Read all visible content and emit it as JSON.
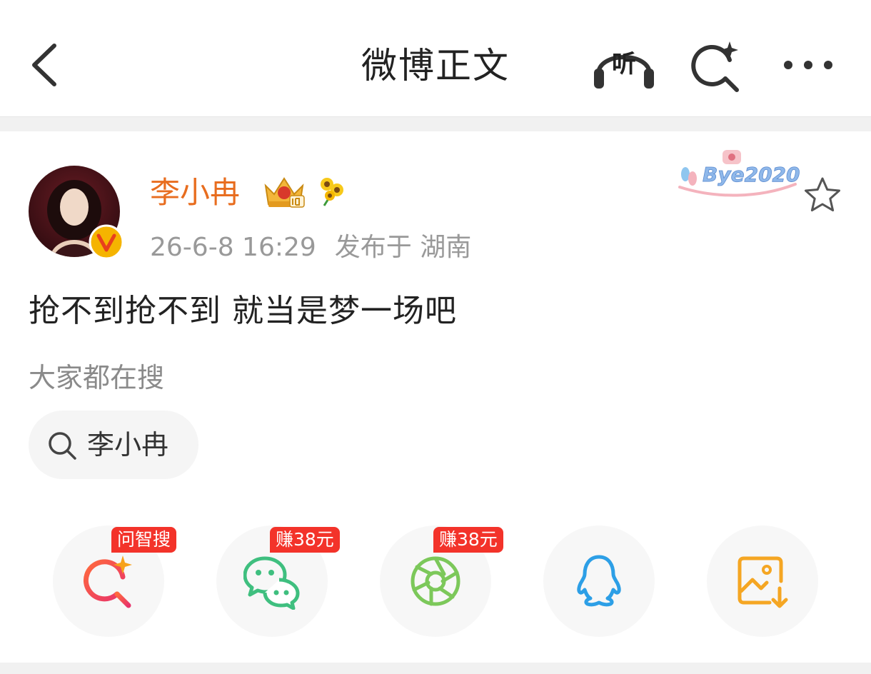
{
  "header": {
    "title": "微博正文",
    "listen_label": "听"
  },
  "post": {
    "author": {
      "name": "李小冉"
    },
    "time": "26-6-8 16:29",
    "location": "发布于 湖南",
    "content": "抢不到抢不到 就当是梦一场吧",
    "decoration_text": "Bye2020"
  },
  "trending": {
    "label": "大家都在搜",
    "chips": [
      "李小冉"
    ]
  },
  "share": {
    "items": [
      {
        "icon": "ai-search-icon",
        "badge": "问智搜",
        "color": "#ef4a5c"
      },
      {
        "icon": "wechat-icon",
        "badge": "赚38元",
        "color": "#3fbf7f"
      },
      {
        "icon": "moments-icon",
        "badge": "赚38元",
        "color": "#7cc85a"
      },
      {
        "icon": "qq-icon",
        "badge": "",
        "color": "#2d9fe6"
      },
      {
        "icon": "save-image-icon",
        "badge": "",
        "color": "#f5a623"
      }
    ]
  },
  "colors": {
    "username": "#e86d1f",
    "badge_bg": "#f3332a",
    "meta": "#999999"
  }
}
